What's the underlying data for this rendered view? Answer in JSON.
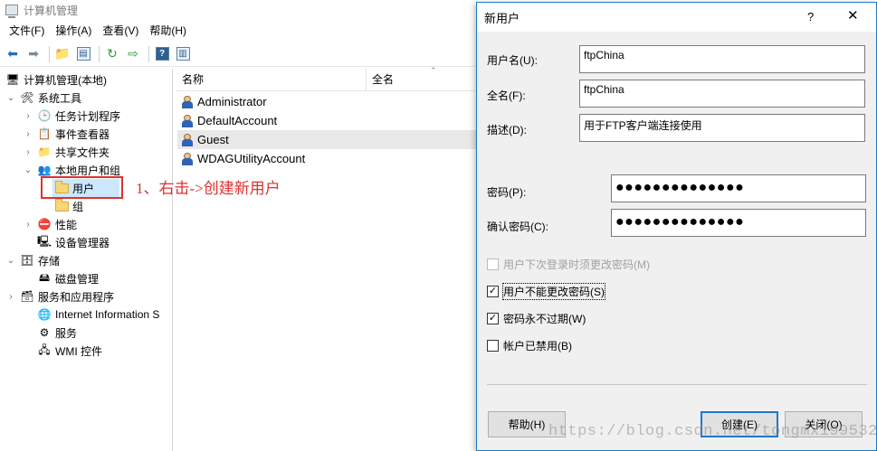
{
  "main_window": {
    "title": "计算机管理",
    "menu": [
      "文件(F)",
      "操作(A)",
      "查看(V)",
      "帮助(H)"
    ],
    "tree": {
      "root": "计算机管理(本地)",
      "system_tools": "系统工具",
      "task_scheduler": "任务计划程序",
      "event_viewer": "事件查看器",
      "shared_folders": "共享文件夹",
      "local_users_groups": "本地用户和组",
      "users": "用户",
      "groups": "组",
      "performance": "性能",
      "device_manager": "设备管理器",
      "storage": "存储",
      "disk_management": "磁盘管理",
      "services_apps": "服务和应用程序",
      "iis": "Internet Information S",
      "services": "服务",
      "wmi": "WMI 控件"
    },
    "list": {
      "columns": [
        "名称",
        "全名"
      ],
      "rows": [
        "Administrator",
        "DefaultAccount",
        "Guest",
        "WDAGUtilityAccount"
      ]
    }
  },
  "annotation": "1、右击->创建新用户",
  "dialog": {
    "title": "新用户",
    "help_glyph": "?",
    "close_glyph": "✕",
    "fields": {
      "username": {
        "label": "用户名(U):",
        "value": "ftpChina"
      },
      "fullname": {
        "label": "全名(F):",
        "value": "ftpChina"
      },
      "description": {
        "label": "描述(D):",
        "value": "用于FTP客户端连接使用"
      },
      "password": {
        "label": "密码(P):",
        "value": "●●●●●●●●●●●●●●"
      },
      "confirm": {
        "label": "确认密码(C):",
        "value": "●●●●●●●●●●●●●●"
      }
    },
    "checkboxes": {
      "must_change": {
        "label": "用户下次登录时须更改密码(M)",
        "checked": false,
        "disabled": true
      },
      "cannot_change": {
        "label": "用户不能更改密码(S)",
        "checked": true
      },
      "never_expires": {
        "label": "密码永不过期(W)",
        "checked": true
      },
      "disabled": {
        "label": "帐户已禁用(B)",
        "checked": false
      }
    },
    "buttons": {
      "help": "帮助(H)",
      "create": "创建(E)",
      "close": "关闭(O)"
    }
  },
  "watermark": "https://blog.csdn.net/tongmx1995328",
  "colors": {
    "accent": "#1979ca",
    "annotation": "#e0312f",
    "selection": "#cce8ff"
  }
}
